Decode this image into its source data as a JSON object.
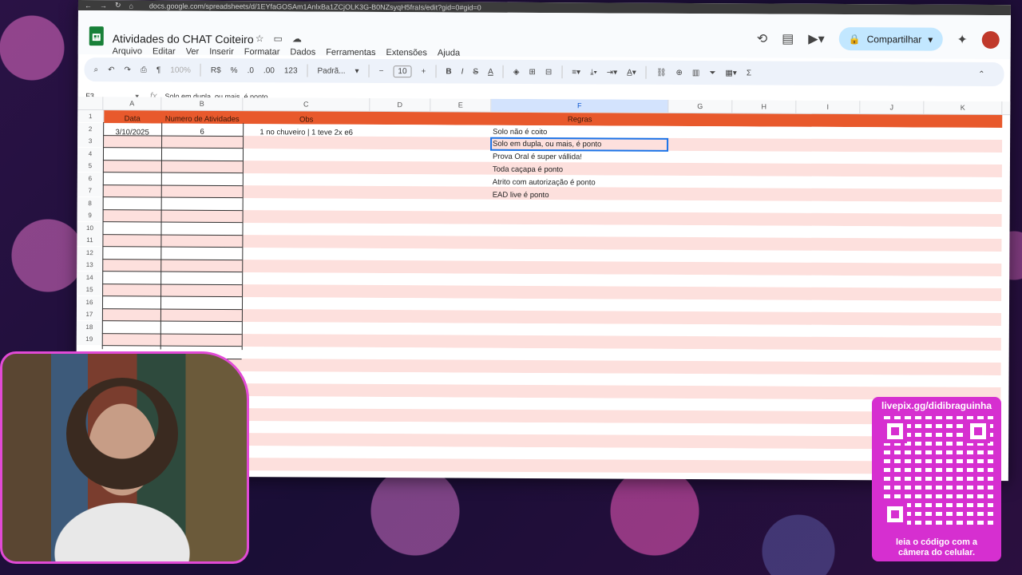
{
  "browser": {
    "url": "docs.google.com/spreadsheets/d/1EYfaGOSAm1AnlxBa1ZCjOLK3G-B0NZsyqH5fraIs/edit?gid=0#gid=0"
  },
  "header": {
    "doc_title": "Atividades do CHAT Coiteiro",
    "menu": [
      "Arquivo",
      "Editar",
      "Ver",
      "Inserir",
      "Formatar",
      "Dados",
      "Ferramentas",
      "Extensões",
      "Ajuda"
    ],
    "share_label": "Compartilhar"
  },
  "toolbar": {
    "zoom": "100%",
    "currency": "R$",
    "percent": "%",
    "dec_decrease": ".0",
    "dec_increase": ".00",
    "number_format": "123",
    "font": "Padrã...",
    "font_size": "10"
  },
  "formula_bar": {
    "cell_ref": "F3",
    "fx": "fx",
    "content": "Solo em dupla, ou mais, é ponto"
  },
  "grid": {
    "columns": [
      "A",
      "B",
      "C",
      "D",
      "E",
      "F",
      "G",
      "H",
      "I",
      "J",
      "K"
    ],
    "rows": [
      "1",
      "2",
      "3",
      "4",
      "5",
      "6",
      "7",
      "8",
      "9",
      "10",
      "11",
      "12",
      "13",
      "14",
      "15",
      "16",
      "17",
      "18",
      "19"
    ],
    "headers": {
      "data": "Data",
      "numero": "Numero de Atividades",
      "obs": "Obs",
      "regras": "Regras"
    },
    "row2": {
      "date": "3/10/2025",
      "count": "6",
      "obs": "1 no chuveiro  | 1 teve 2x e6"
    },
    "rules": [
      "Solo não é coito",
      "Solo em dupla, ou mais, é ponto",
      "Prova Oral é super vállida!",
      "Toda caçapa é ponto",
      "Atrito com autorização é ponto",
      "EAD live é ponto"
    ]
  },
  "overlay": {
    "qr_url": "livepix.gg/didibraguinha",
    "qr_caption_1": "leia o código com a",
    "qr_caption_2": "câmera do celular."
  }
}
